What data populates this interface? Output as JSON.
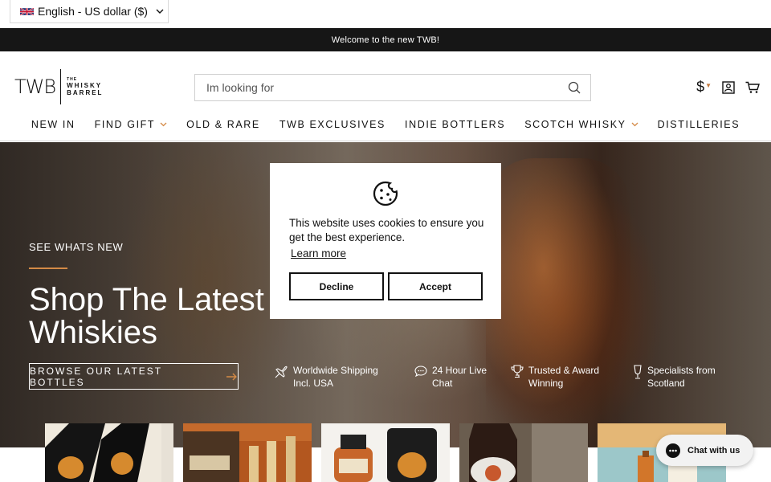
{
  "locale": {
    "label": "English - US dollar ($)"
  },
  "announcement": {
    "text": "Welcome to the new TWB!"
  },
  "header": {
    "logo_mark": "TWB",
    "logo_words": [
      "THE",
      "WHISKY",
      "BARREL"
    ],
    "search_placeholder": "Im looking for",
    "currency_symbol": "$"
  },
  "nav": [
    {
      "label": "NEW IN",
      "dropdown": false
    },
    {
      "label": "FIND GIFT",
      "dropdown": true
    },
    {
      "label": "OLD & RARE",
      "dropdown": false
    },
    {
      "label": "TWB EXCLUSIVES",
      "dropdown": false
    },
    {
      "label": "INDIE BOTTLERS",
      "dropdown": false
    },
    {
      "label": "SCOTCH WHISKY",
      "dropdown": true
    },
    {
      "label": "DISTILLERIES",
      "dropdown": false
    }
  ],
  "hero": {
    "eyebrow": "SEE WHATS NEW",
    "title": "Shop The Latest Whiskies",
    "cta": "BROWSE OUR LATEST BOTTLES"
  },
  "usps": [
    {
      "icon": "plane-icon",
      "line1": "Worldwide Shipping",
      "line2": "Incl. USA"
    },
    {
      "icon": "chat-bubble-icon",
      "line1": "24 Hour Live",
      "line2": "Chat"
    },
    {
      "icon": "trophy-icon",
      "line1": "Trusted & Award",
      "line2": "Winning"
    },
    {
      "icon": "glass-icon",
      "line1": "Specialists from",
      "line2": "Scotland"
    }
  ],
  "cookie": {
    "message": "This website uses cookies to ensure you get the best experience.",
    "link": "Learn more",
    "decline": "Decline",
    "accept": "Accept"
  },
  "chat": {
    "label": "Chat with us"
  },
  "colors": {
    "accent": "#d48a46",
    "announce_bg": "#161616",
    "chat_bg": "#f2f2f2"
  }
}
